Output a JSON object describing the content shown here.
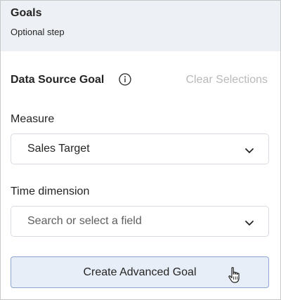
{
  "header": {
    "title": "Goals",
    "subtitle": "Optional step"
  },
  "section": {
    "title": "Data Source Goal",
    "info_icon": "info-icon",
    "clear_label": "Clear Selections"
  },
  "measure": {
    "label": "Measure",
    "value": "Sales Target"
  },
  "time_dimension": {
    "label": "Time dimension",
    "placeholder": "Search or select a field"
  },
  "create_button": {
    "label": "Create Advanced Goal"
  },
  "colors": {
    "header_bg": "#edf1f5",
    "button_bg": "#e8eef8",
    "button_border": "#8aa8cf",
    "disabled_text": "#b9b9b9"
  }
}
